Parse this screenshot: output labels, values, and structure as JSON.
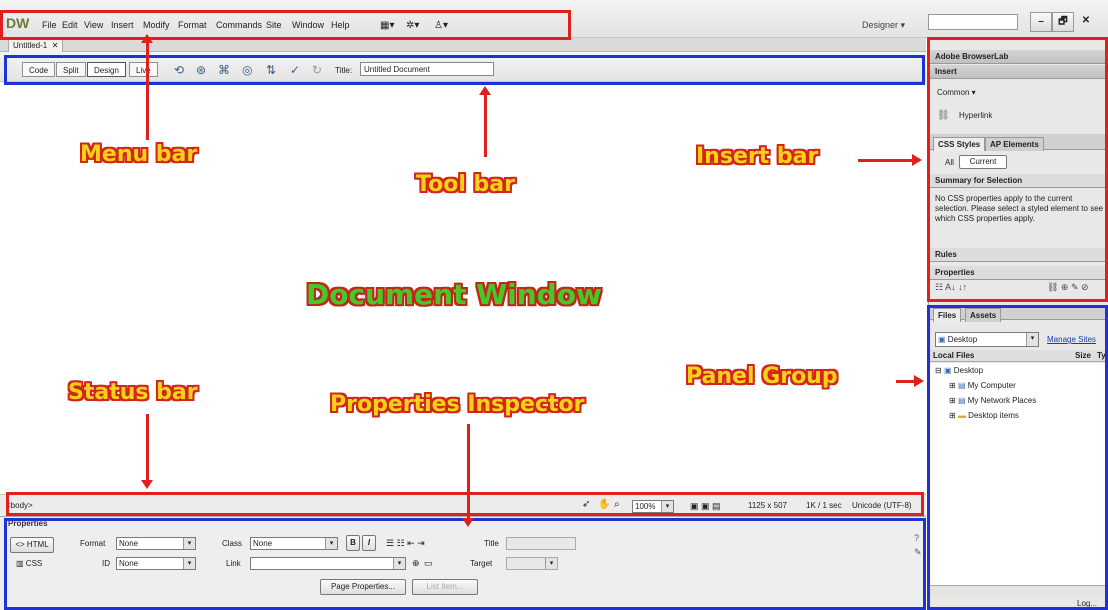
{
  "app": {
    "logo_main": "D",
    "logo_accent": "W",
    "workspace": "Designer"
  },
  "menu": [
    "File",
    "Edit",
    "View",
    "Insert",
    "Modify",
    "Format",
    "Commands",
    "Site",
    "Window",
    "Help"
  ],
  "window_buttons": [
    "–",
    "🗗",
    "✕"
  ],
  "document": {
    "tab": "Untitled-1",
    "tab_close": "✕"
  },
  "toolbar": {
    "views": [
      "Code",
      "Split",
      "Design",
      "Live"
    ],
    "active_view": "Design",
    "title_label": "Title:",
    "title_value": "Untitled Document"
  },
  "status": {
    "tag": "<body>",
    "zoom": "100%",
    "size": "1125 x 507",
    "download": "1K / 1 sec",
    "encoding": "Unicode (UTF-8)"
  },
  "properties": {
    "title": "Properties",
    "html_label": "HTML",
    "css_label": "CSS",
    "format_label": "Format",
    "format_value": "None",
    "id_label": "ID",
    "id_value": "None",
    "class_label": "Class",
    "class_value": "None",
    "link_label": "Link",
    "link_value": "",
    "title_label": "Title",
    "target_label": "Target",
    "bold": "B",
    "italic": "I",
    "page_properties": "Page Properties...",
    "list_item": "List Item..."
  },
  "panels": {
    "browserlab": "Adobe BrowserLab",
    "insert": "Insert",
    "insert_category": "Common",
    "insert_item": "Hyperlink",
    "css_tab": "CSS Styles",
    "ap_tab": "AP Elements",
    "all": "All",
    "current": "Current",
    "summary_title": "Summary for Selection",
    "summary_text": "No CSS properties apply to the current selection.  Please select a styled element to see which CSS properties apply.",
    "rules": "Rules",
    "properties": "Properties",
    "files_tab": "Files",
    "assets_tab": "Assets",
    "site_select": "Desktop",
    "manage_sites": "Manage Sites",
    "local_files": "Local Files",
    "size_col": "Size",
    "type_col": "Ty",
    "tree": [
      "Desktop",
      "My Computer",
      "My Network Places",
      "Desktop items"
    ],
    "log": "Log..."
  },
  "annotations": {
    "menu_bar": "Menu bar",
    "tool_bar": "Tool bar",
    "insert_bar": "Insert bar",
    "document_window": "Document Window",
    "status_bar": "Status bar",
    "properties_inspector": "Properties Inspector",
    "panel_group": "Panel Group"
  },
  "colors": {
    "annotation_red": "#e0201c",
    "annotation_blue": "#1e32d8",
    "label_yellow": "#f6d21a",
    "label_green": "#48c828"
  }
}
